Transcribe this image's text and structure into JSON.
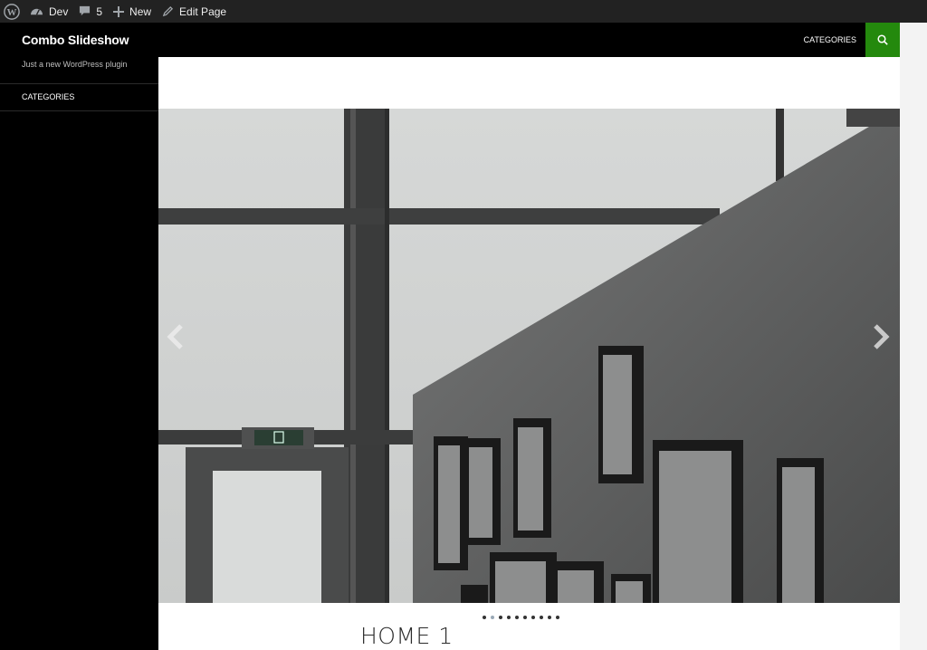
{
  "adminbar": {
    "site_name": "Dev",
    "comments_count": "5",
    "new_label": "New",
    "edit_label": "Edit Page"
  },
  "site": {
    "title": "Combo Slideshow",
    "description": "Just a new WordPress plugin"
  },
  "nav": {
    "side_item": "CATEGORIES",
    "top_item": "CATEGORIES"
  },
  "slideshow": {
    "slide_count": 10,
    "active_index": 1
  },
  "entry": {
    "title": "HOME 1"
  },
  "colors": {
    "accent": "#24890d",
    "adminbar": "#222222",
    "header": "#000000"
  },
  "icons": {
    "wp": "wordpress-logo-icon",
    "dashboard": "dashboard-icon",
    "comments": "comment-icon",
    "new": "plus-icon",
    "edit": "pencil-icon",
    "search": "search-icon",
    "prev": "chevron-left-icon",
    "next": "chevron-right-icon"
  }
}
